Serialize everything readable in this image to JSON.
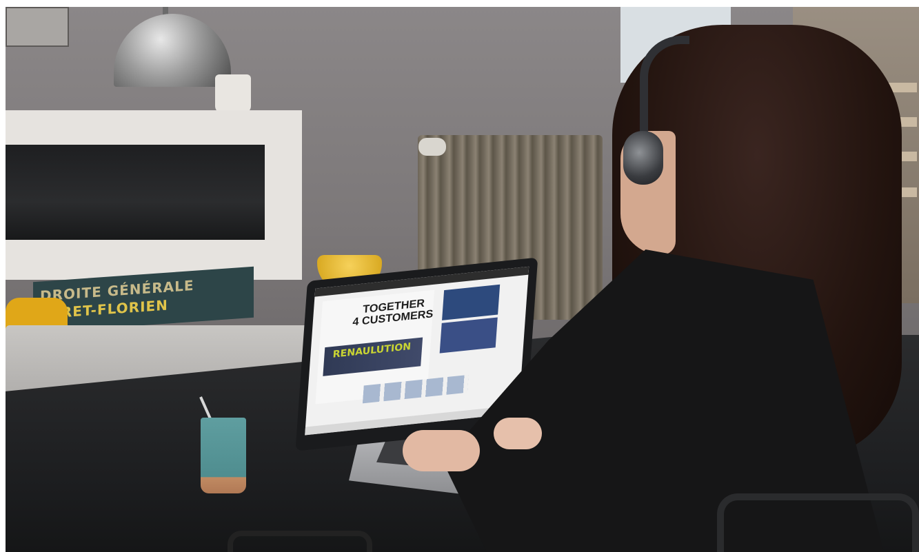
{
  "scene": {
    "description_type": "photo",
    "sign_lines": [
      "DROITE GÉNÉRALE",
      "BERET-FLORIEN"
    ],
    "screen": {
      "hero_title_line1": "TOGETHER",
      "hero_title_line2": "4 CUSTOMERS",
      "graffiti": "RENAULUTION"
    }
  }
}
